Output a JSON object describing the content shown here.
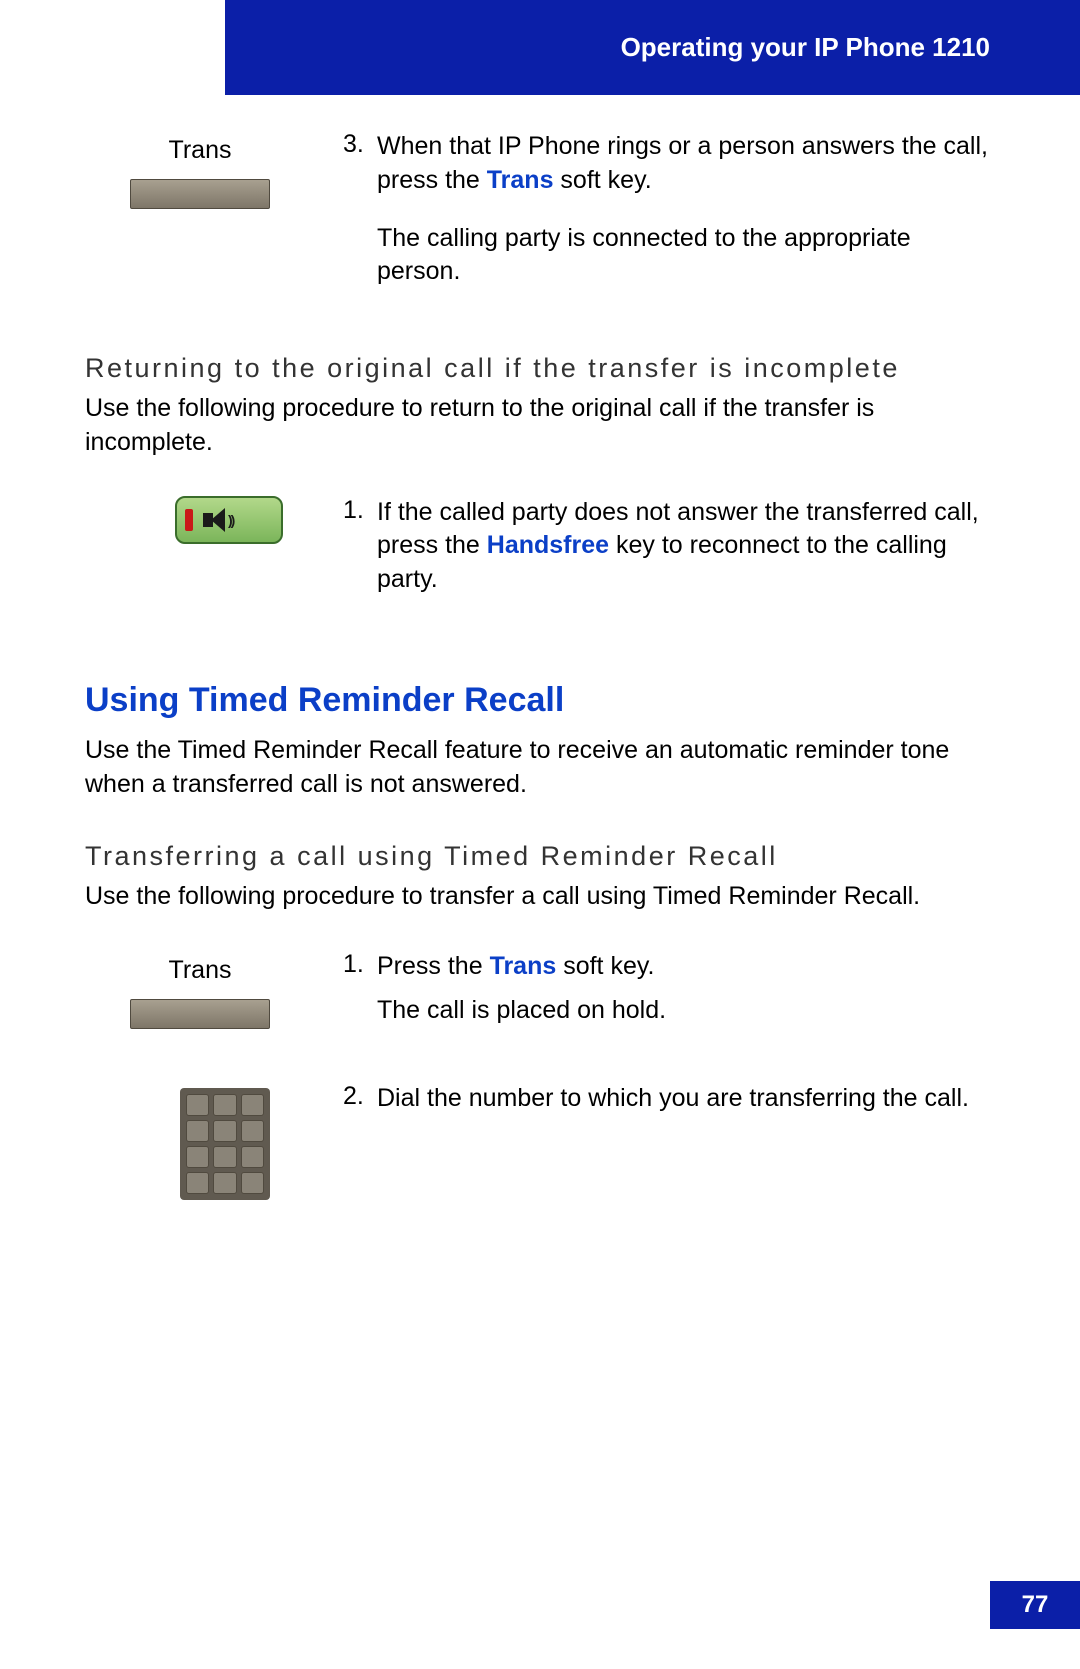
{
  "header": {
    "title": "Operating your IP Phone 1210"
  },
  "step3": {
    "label": "Trans",
    "num": "3.",
    "text1_a": "When that IP Phone rings or a person answers the call, press the ",
    "text1_kw": "Trans",
    "text1_b": " soft key.",
    "text2": "The calling party is connected to the appropriate person."
  },
  "section1": {
    "heading": "Returning to the original call if the transfer is incomplete",
    "intro": "Use the following procedure to return to the original call if the transfer is incomplete."
  },
  "step_hf": {
    "num": "1.",
    "text_a": "If the called party does not answer the transferred call, press the ",
    "text_kw": "Handsfree",
    "text_b": " key to reconnect to the calling party."
  },
  "section2": {
    "heading": "Using Timed Reminder Recall",
    "intro": "Use the Timed Reminder Recall feature to receive an automatic reminder tone when a transferred call is not answered."
  },
  "section3": {
    "heading": "Transferring a call using Timed Reminder Recall",
    "intro": "Use the following procedure to transfer a call using Timed Reminder Recall."
  },
  "step_t1": {
    "label": "Trans",
    "num": "1.",
    "text_a": "Press the ",
    "text_kw": "Trans",
    "text_b": " soft key.",
    "text2": "The call is placed on hold."
  },
  "step_t2": {
    "num": "2.",
    "text": "Dial the number to which you are transferring the call."
  },
  "page_number": "77"
}
